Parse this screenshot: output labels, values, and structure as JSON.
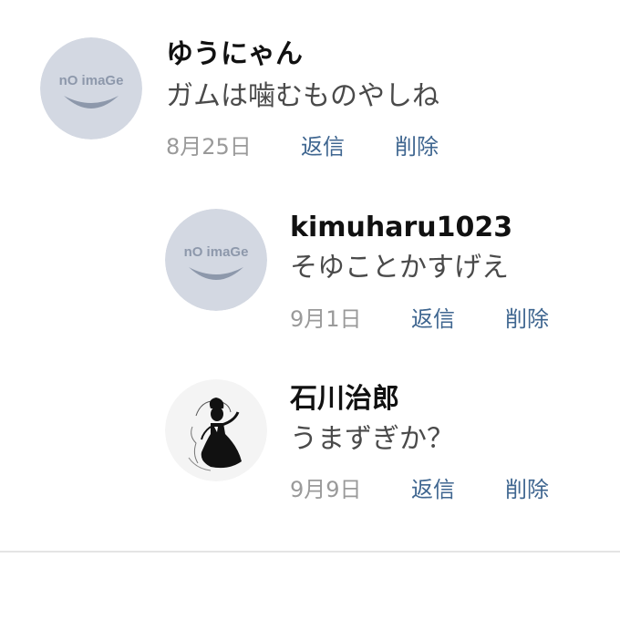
{
  "comments": [
    {
      "name": "ゆうにゃん",
      "text": "ガムは噛むものやしね",
      "date": "8月25日",
      "reply": "返信",
      "delete": "削除",
      "avatar_text": "nO imaGe"
    },
    {
      "name": "kimuharu1023",
      "text": "そゆことかすげえ",
      "date": "9月1日",
      "reply": "返信",
      "delete": "削除",
      "avatar_text": "nO imaGe"
    },
    {
      "name": "石川治郎",
      "text": "うまずぎか？",
      "date": "9月9日",
      "reply": "返信",
      "delete": "削除"
    }
  ],
  "colors": {
    "link": "#3f6690",
    "date": "#9a9a9a",
    "placeholder_bg": "#d3d8e2",
    "placeholder_fg": "#8d98ab"
  }
}
